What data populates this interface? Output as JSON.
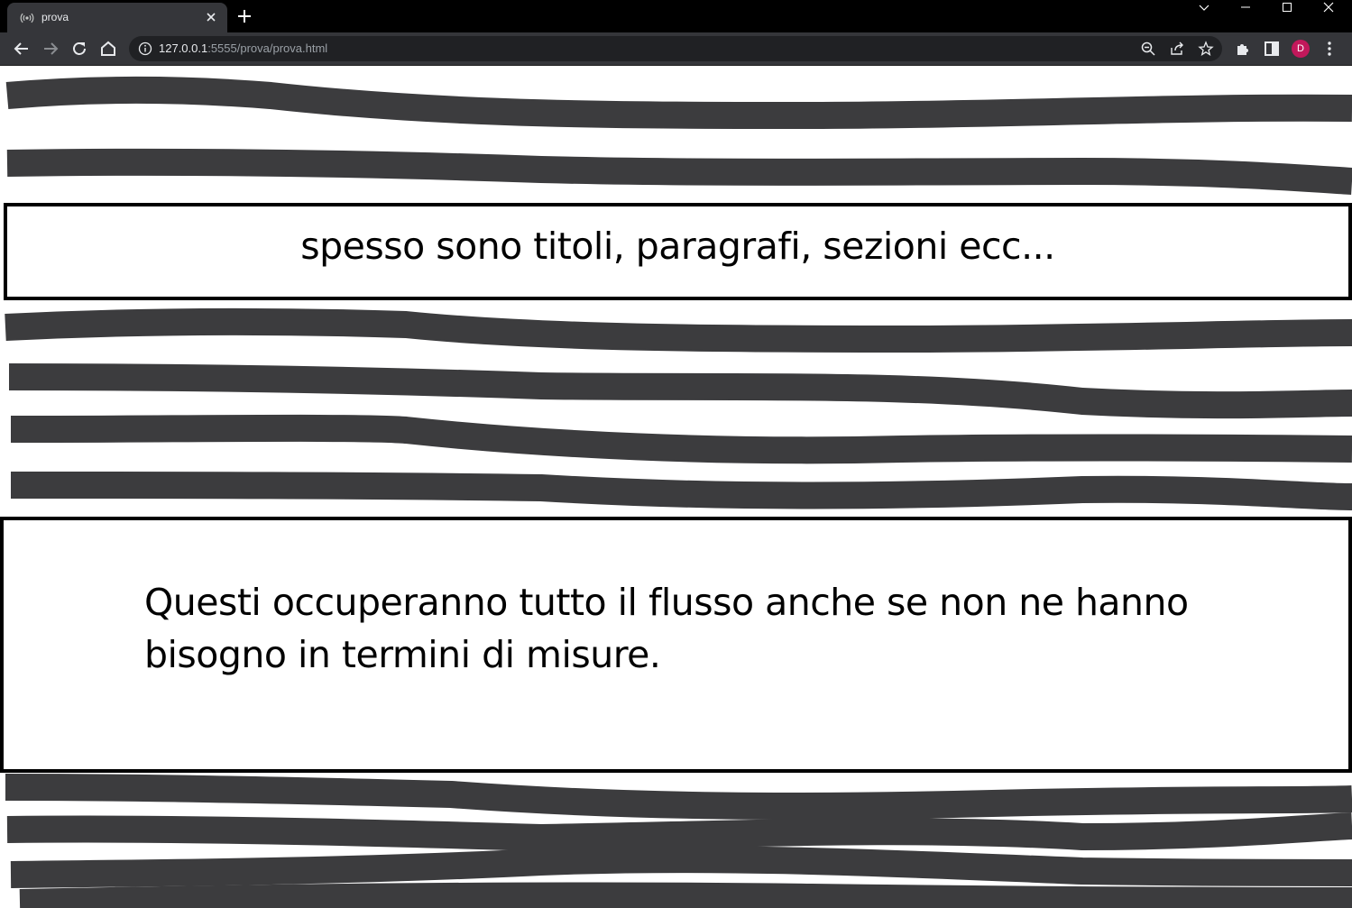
{
  "browser": {
    "tab_title": "prova",
    "url_host": "127.0.0.1",
    "url_rest": ":5555/prova/prova.html",
    "profile_initial": "D",
    "icons": [
      "broadcast-icon",
      "close-icon",
      "plus-icon",
      "chevron-down-icon",
      "minimize-icon",
      "maximize-icon",
      "close-icon",
      "back-icon",
      "forward-icon",
      "reload-icon",
      "home-icon",
      "info-icon",
      "zoom-icon",
      "share-icon",
      "star-icon",
      "extensions-icon",
      "side-panel-icon",
      "menu-icon"
    ]
  },
  "page": {
    "title_box_text": "spesso sono titoli, paragrafi, sezioni ecc...",
    "paragraph_box_text": "Questi occuperanno tutto il flusso anche se non ne hanno bisogno in termini di misure."
  },
  "colors": {
    "scribble": "#3c3c3e",
    "chrome_toolbar": "#35363a",
    "tabstrip": "#000000",
    "avatar": "#c2185b"
  }
}
